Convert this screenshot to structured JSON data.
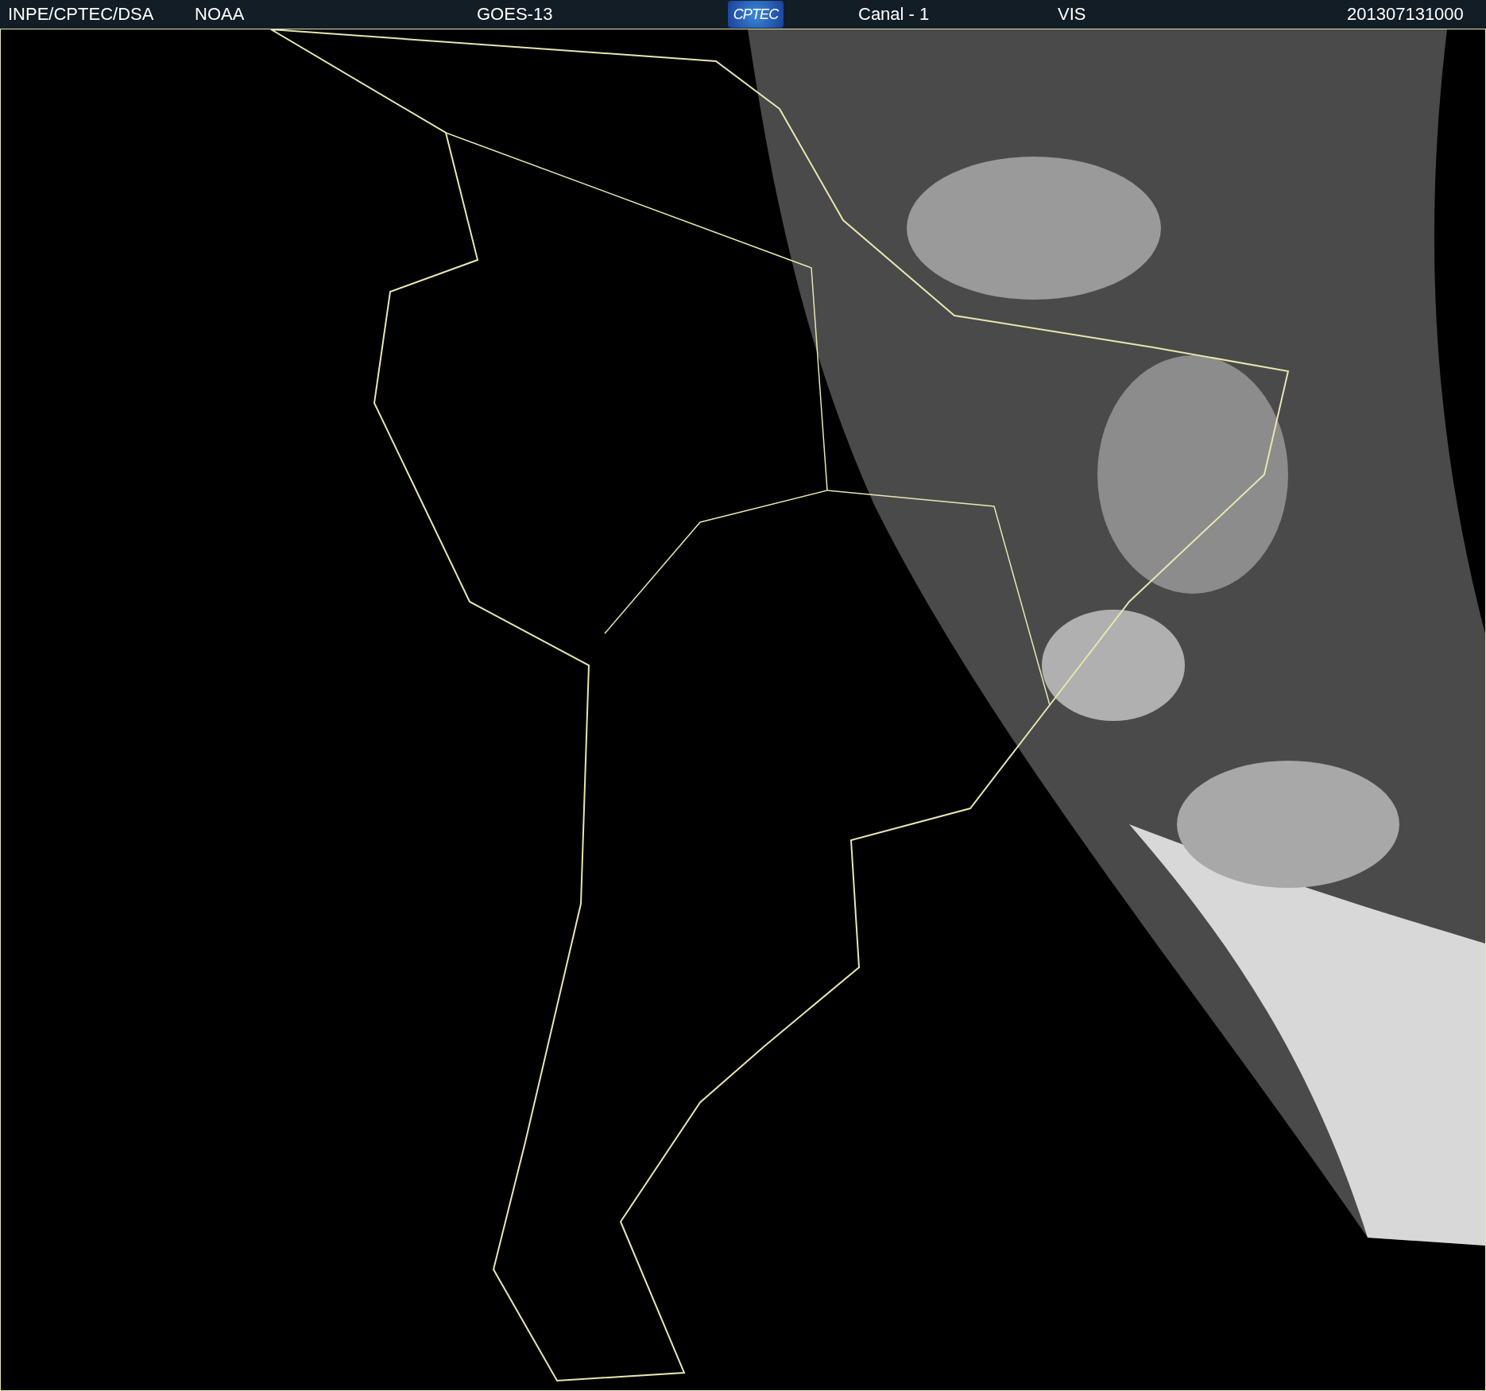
{
  "header": {
    "source": "INPE/CPTEC/DSA",
    "agency": "NOAA",
    "satellite": "GOES-13",
    "logo": "CPTEC",
    "channel": "Canal - 1",
    "band": "VIS",
    "timestamp": "201307131000"
  }
}
